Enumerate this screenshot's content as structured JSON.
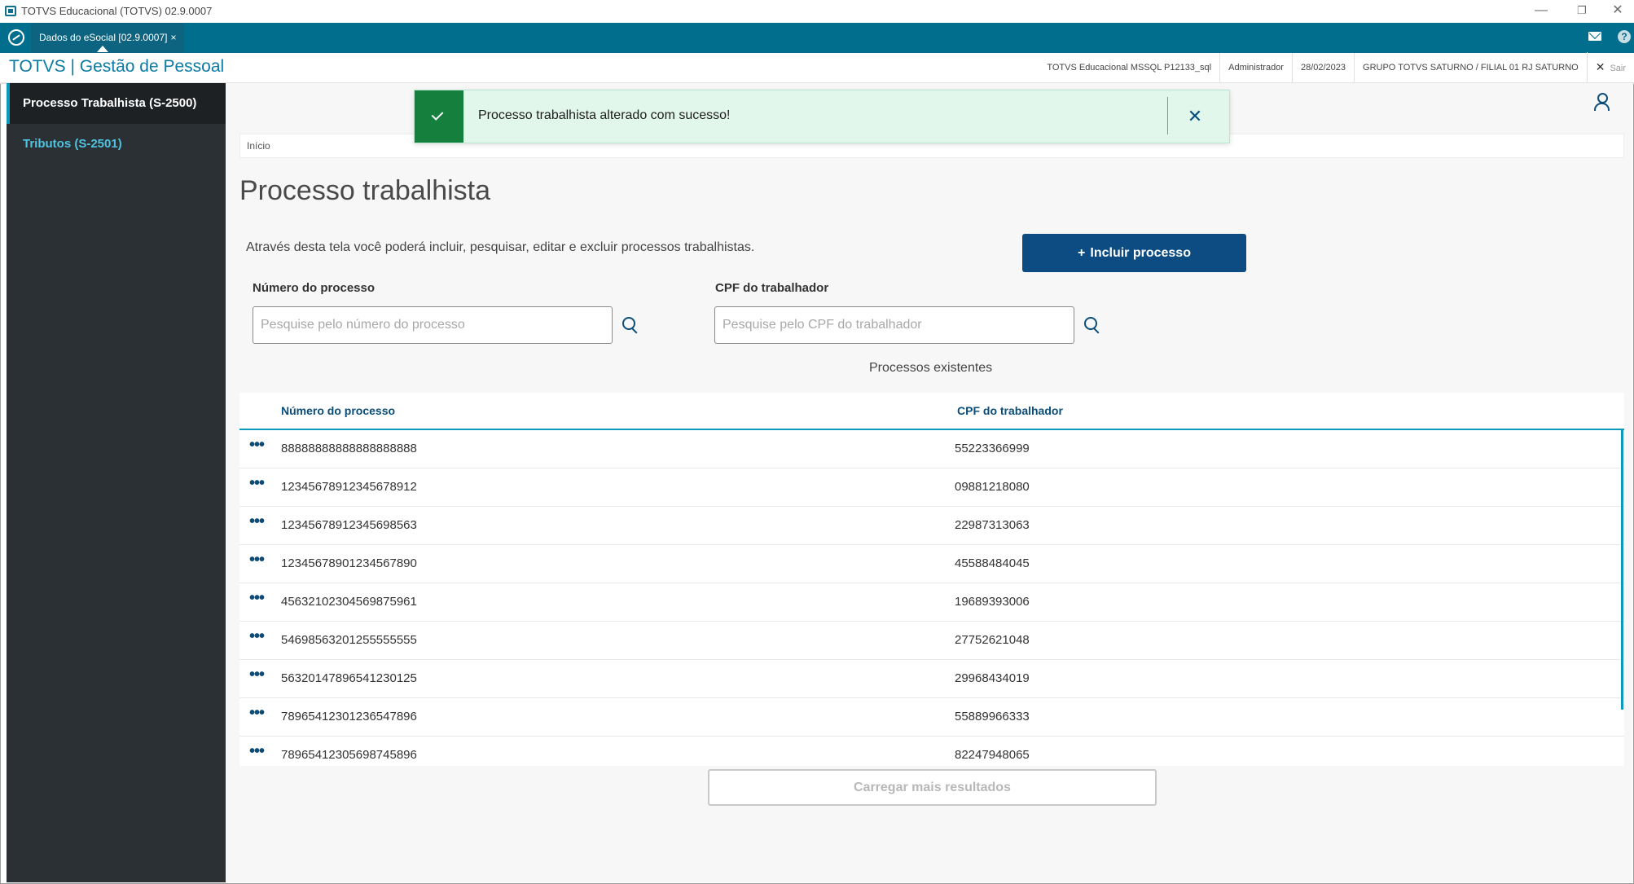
{
  "window": {
    "title": "TOTVS Educacional (TOTVS) 02.9.0007",
    "controls": {
      "minimize": "—",
      "restore": "❐",
      "close": "✕"
    }
  },
  "tabbar": {
    "tab_label": "Dados do eSocial [02.9.0007]",
    "tab_close": "×",
    "help_label": "?"
  },
  "header": {
    "brand": "TOTVS | Gestão de Pessoal",
    "database": "TOTVS Educacional MSSQL P12133_sql",
    "user": "Administrador",
    "date": "28/02/2023",
    "branch": "GRUPO TOTVS SATURNO / FILIAL 01 RJ SATURNO",
    "exit_label": "Sair",
    "exit_icon": "✕"
  },
  "sidebar": {
    "items": [
      {
        "label": "Processo Trabalhista (S-2500)"
      },
      {
        "label": "Tributos (S-2501)"
      }
    ]
  },
  "toast": {
    "message": "Processo trabalhista alterado com sucesso!",
    "close": "✕"
  },
  "breadcrumb": {
    "label": "Início"
  },
  "page": {
    "title": "Processo trabalhista",
    "description": "Através desta tela você poderá incluir, pesquisar, editar e excluir processos trabalhistas.",
    "add_button": "Incluir processo",
    "add_button_plus": "+"
  },
  "filters": {
    "process_label": "Número do processo",
    "process_placeholder": "Pesquise pelo número do processo",
    "cpf_label": "CPF do trabalhador",
    "cpf_placeholder": "Pesquise pelo CPF do trabalhador"
  },
  "table": {
    "caption": "Processos existentes",
    "columns": [
      "Número do processo",
      "CPF do trabalhador"
    ],
    "row_actions": "•••",
    "rows": [
      {
        "processo": "88888888888888888888",
        "cpf": "55223366999"
      },
      {
        "processo": "12345678912345678912",
        "cpf": "09881218080"
      },
      {
        "processo": "12345678912345698563",
        "cpf": "22987313063"
      },
      {
        "processo": "12345678901234567890",
        "cpf": "45588484045"
      },
      {
        "processo": "45632102304569875961",
        "cpf": "19689393006"
      },
      {
        "processo": "54698563201255555555",
        "cpf": "27752621048"
      },
      {
        "processo": "56320147896541230125",
        "cpf": "29968434019"
      },
      {
        "processo": "78965412301236547896",
        "cpf": "55889966333"
      },
      {
        "processo": "78965412305698745896",
        "cpf": "82247948065"
      }
    ]
  },
  "load_more": "Carregar mais resultados",
  "colors": {
    "tabbar": "#006e8c",
    "brand": "#0b7aa4",
    "primary_button": "#0c4c82",
    "sidebar": "#2a3033",
    "sidebar_link": "#4fc3e0",
    "toast_success": "#157f3d",
    "toast_background": "#e2f7ec"
  }
}
